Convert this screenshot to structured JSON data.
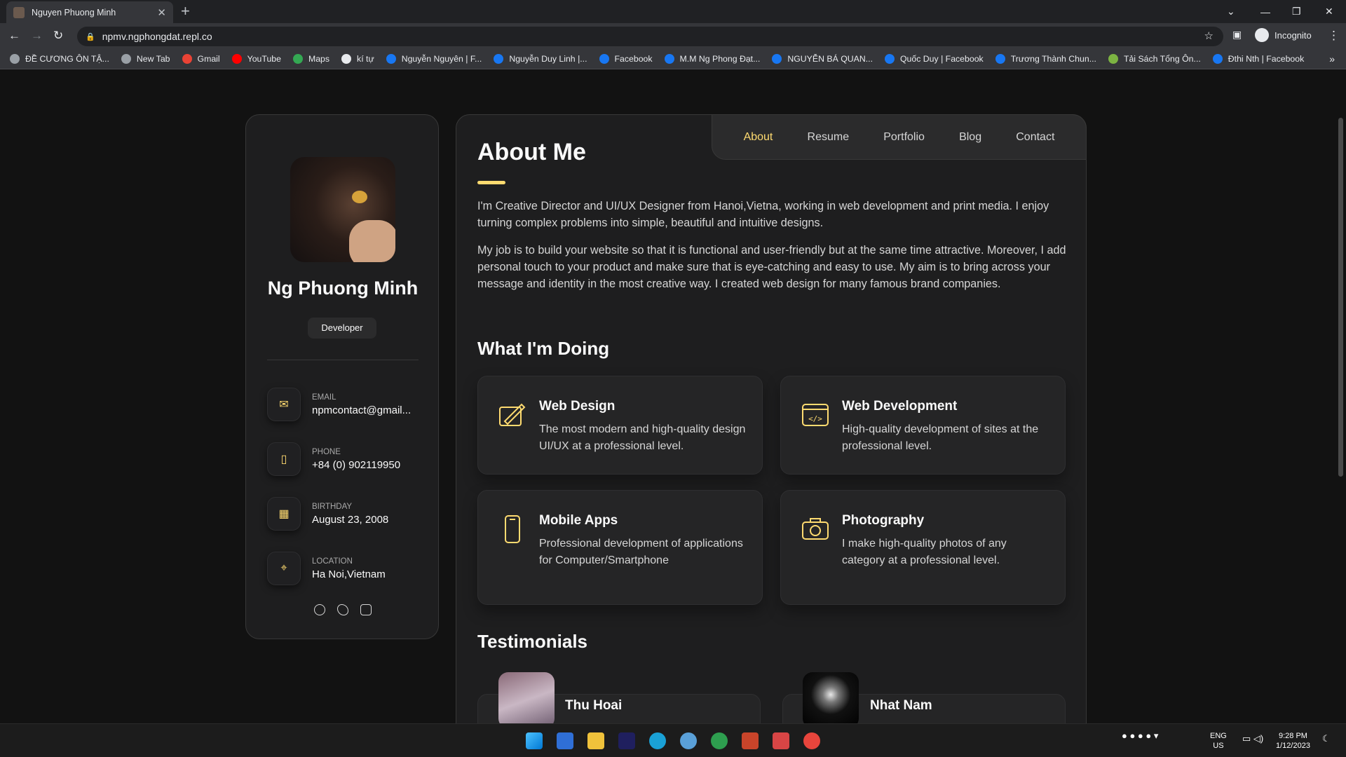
{
  "browser": {
    "tab_title": "Nguyen Phuong Minh",
    "url": "npmv.ngphongdat.repl.co",
    "profile": "Incognito",
    "bookmarks": [
      "ĐỀ CƯƠNG ÔN TẬ...",
      "New Tab",
      "Gmail",
      "YouTube",
      "Maps",
      "kí tự",
      "Nguyễn Nguyên | F...",
      "Nguyễn Duy Linh |...",
      "Facebook",
      "M.M Ng Phong Đạt...",
      "NGUYỄN BÁ QUAN...",
      "Quốc Duy | Facebook",
      "Trương Thành Chun...",
      "Tải Sách Tổng Ôn...",
      "Đthi Nth | Facebook"
    ]
  },
  "sidebar": {
    "name": "Ng Phuong Minh",
    "role": "Developer",
    "contacts": [
      {
        "label": "Email",
        "value": "npmcontact@gmail..."
      },
      {
        "label": "Phone",
        "value": "+84 (0) 902119950"
      },
      {
        "label": "Birthday",
        "value": "August 23, 2008"
      },
      {
        "label": "Location",
        "value": "Ha Noi,Vietnam"
      }
    ]
  },
  "nav": {
    "items": [
      "About",
      "Resume",
      "Portfolio",
      "Blog",
      "Contact"
    ],
    "active": "About"
  },
  "about": {
    "title": "About Me",
    "p1": "I'm Creative Director and UI/UX Designer from Hanoi,Vietna, working in web development and print media. I enjoy turning complex problems into simple, beautiful and intuitive designs.",
    "p2": "My job is to build your website so that it is functional and user-friendly but at the same time attractive. Moreover, I add personal touch to your product and make sure that is eye-catching and easy to use. My aim is to bring across your message and identity in the most creative way. I created web design for many famous brand companies."
  },
  "services": {
    "title": "What I'm Doing",
    "items": [
      {
        "title": "Web Design",
        "desc": "The most modern and high-quality design UI/UX at a professional level.",
        "icon": "design-icon"
      },
      {
        "title": "Web Development",
        "desc": "High-quality development of sites at the professional level.",
        "icon": "code-icon"
      },
      {
        "title": "Mobile Apps",
        "desc": "Professional development of applications for Computer/Smartphone",
        "icon": "smartphone-icon"
      },
      {
        "title": "Photography",
        "desc": "I make high-quality photos of any category at a professional level.",
        "icon": "camera-icon"
      }
    ]
  },
  "testimonials": {
    "title": "Testimonials",
    "items": [
      {
        "name": "Thu Hoai"
      },
      {
        "name": "Nhat Nam"
      }
    ]
  },
  "taskbar": {
    "lang1": "ENG",
    "lang2": "US",
    "time": "9:28 PM",
    "date": "1/12/2023"
  },
  "colors": {
    "accent": "#ffdb70",
    "bg": "#121212",
    "card": "#1e1e1f"
  }
}
